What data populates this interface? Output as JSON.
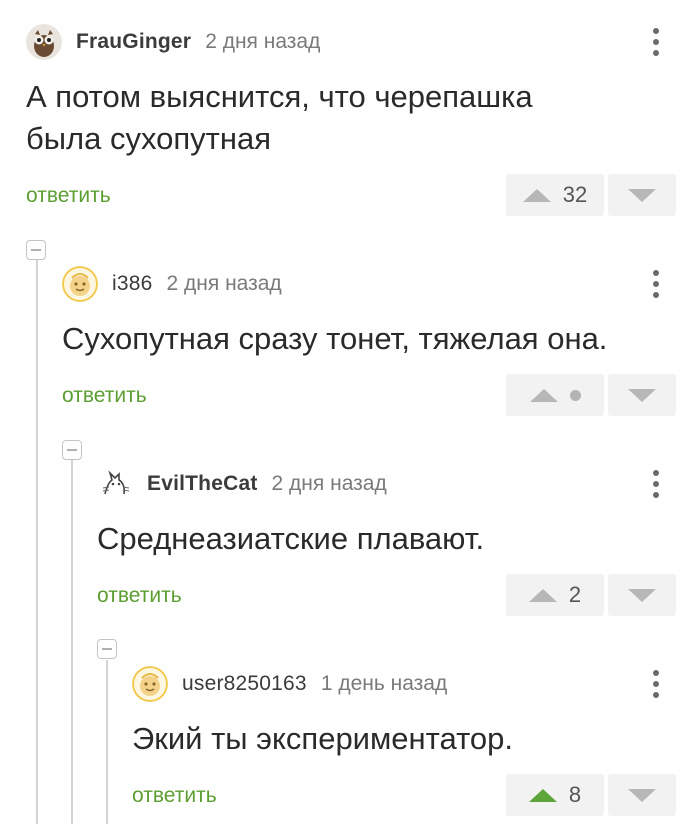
{
  "comments": [
    {
      "username": "FrauGinger",
      "time": "2 дня назад",
      "text": "А потом выяснится, что черепашка\nбыла сухопутная",
      "reply_label": "ответить",
      "votes": "32",
      "avatar_icon": "owl-avatar-icon"
    },
    {
      "username": "i386",
      "time": "2 дня назад",
      "text": "Сухопутная сразу тонет, тяжелая она.",
      "reply_label": "ответить",
      "votes": "",
      "avatar_icon": "default-avatar-icon"
    },
    {
      "username": "EvilTheCat",
      "time": "2 дня назад",
      "text": "Среднеазиатские плавают.",
      "reply_label": "ответить",
      "votes": "2",
      "avatar_icon": "cat-sketch-avatar-icon"
    },
    {
      "username": "user8250163",
      "time": "1 день назад",
      "text": "Экий ты экспериментатор.",
      "reply_label": "ответить",
      "votes": "8",
      "avatar_icon": "default-avatar-icon"
    }
  ],
  "colors": {
    "reply_link": "#5d9e33",
    "upvote_active": "#5da53a",
    "vote_bg": "#f2f2f2"
  }
}
